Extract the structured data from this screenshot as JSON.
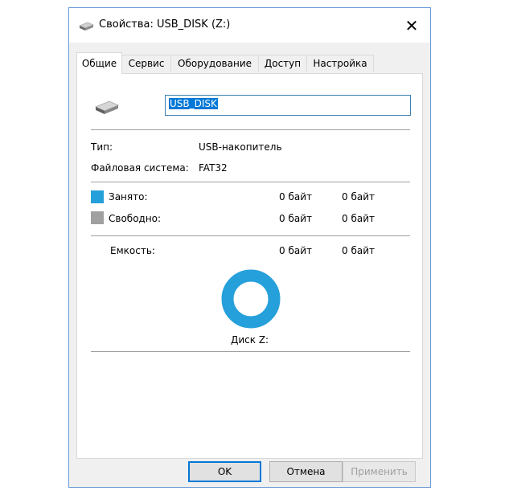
{
  "window": {
    "title": "Свойства: USB_DISK (Z:)",
    "close_glyph": "✕"
  },
  "tabs": [
    {
      "label": "Общие",
      "active": true
    },
    {
      "label": "Сервис",
      "active": false
    },
    {
      "label": "Оборудование",
      "active": false
    },
    {
      "label": "Доступ",
      "active": false
    },
    {
      "label": "Настройка",
      "active": false
    }
  ],
  "general": {
    "volume_name": "USB_DISK",
    "type_label": "Тип:",
    "type_value": "USB-накопитель",
    "fs_label": "Файловая система:",
    "fs_value": "FAT32",
    "used_label": "Занято:",
    "used_bytes": "0 байт",
    "used_size": "0 байт",
    "free_label": "Свободно:",
    "free_bytes": "0 байт",
    "free_size": "0 байт",
    "capacity_label": "Емкость:",
    "capacity_bytes": "0 байт",
    "capacity_size": "0 байт",
    "disk_label": "Диск Z:"
  },
  "colors": {
    "used": "#26a0da",
    "free": "#a0a0a0",
    "accent": "#0078d7"
  },
  "buttons": {
    "ok": "OK",
    "cancel": "Отмена",
    "apply": "Применить"
  }
}
